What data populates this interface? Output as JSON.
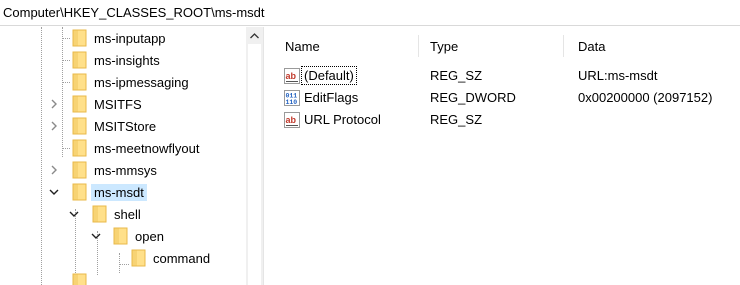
{
  "address": {
    "path": "Computer\\HKEY_CLASSES_ROOT\\ms-msdt"
  },
  "tree": {
    "items": [
      {
        "label": "ms-inputapp",
        "expander": "none"
      },
      {
        "label": "ms-insights",
        "expander": "none"
      },
      {
        "label": "ms-ipmessaging",
        "expander": "none"
      },
      {
        "label": "MSITFS",
        "expander": "collapsed"
      },
      {
        "label": "MSITStore",
        "expander": "collapsed"
      },
      {
        "label": "ms-meetnowflyout",
        "expander": "none"
      },
      {
        "label": "ms-mmsys",
        "expander": "collapsed"
      },
      {
        "label": "ms-msdt",
        "expander": "expanded",
        "selected": true
      },
      {
        "label": "shell",
        "expander": "expanded"
      },
      {
        "label": "open",
        "expander": "expanded"
      },
      {
        "label": "command",
        "expander": "none"
      },
      {
        "label": "",
        "expander": "none"
      }
    ]
  },
  "list": {
    "columns": {
      "name": "Name",
      "type": "Type",
      "data": "Data"
    },
    "rows": [
      {
        "name": "(Default)",
        "type": "REG_SZ",
        "data": "URL:ms-msdt",
        "icon": "string-value-icon"
      },
      {
        "name": "EditFlags",
        "type": "REG_DWORD",
        "data": "0x00200000 (2097152)",
        "icon": "binary-value-icon"
      },
      {
        "name": "URL Protocol",
        "type": "REG_SZ",
        "data": "",
        "icon": "string-value-icon"
      }
    ]
  },
  "colors": {
    "folder": "#ffe08a",
    "folder_dark": "#e8b94a",
    "selection": "#cce8ff",
    "string_icon_red": "#c0392b",
    "binary_icon_blue": "#1f5fbf"
  }
}
